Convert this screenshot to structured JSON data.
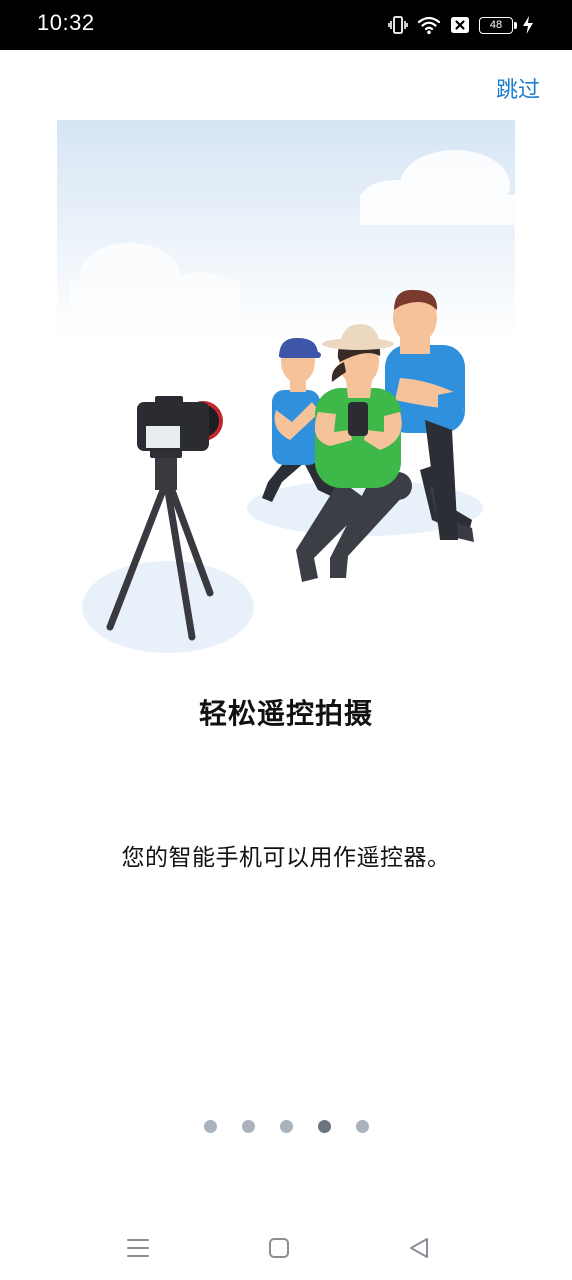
{
  "status_bar": {
    "time": "10:32",
    "battery_level": "48",
    "icons": [
      "vibrate-icon",
      "wifi-icon",
      "no-sim-icon",
      "battery-icon",
      "charging-icon"
    ]
  },
  "header": {
    "skip_label": "跳过",
    "skip_color": "#1e7fd0"
  },
  "main": {
    "title": "轻松遥控拍摄",
    "description": "您的智能手机可以用作遥控器。"
  },
  "pager": {
    "total": 5,
    "active_index": 3
  },
  "nav_bar": {
    "icons": [
      "menu-icon",
      "home-icon",
      "back-icon"
    ]
  }
}
